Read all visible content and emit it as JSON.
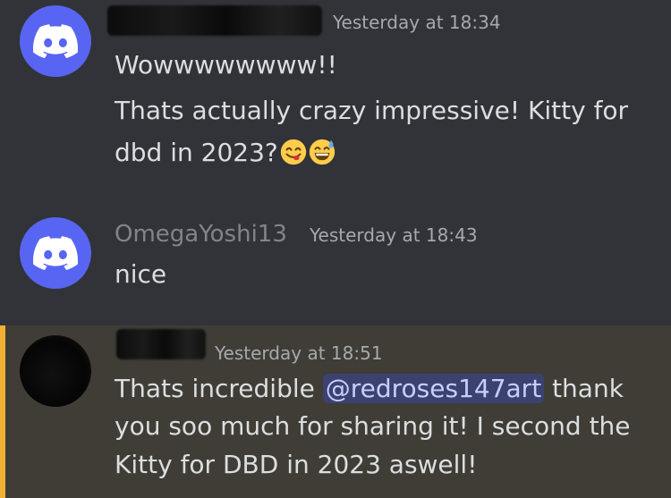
{
  "messages": [
    {
      "author_redacted": true,
      "timestamp": "Yesterday at 18:34",
      "lines": [
        "Wowwwwwwww!!",
        "Thats actually crazy impressive! Kitty for",
        "dbd in 2023?"
      ],
      "emojis": [
        "yum-face",
        "grinning-sweat-face"
      ]
    },
    {
      "author": "OmegaYoshi13",
      "timestamp": "Yesterday at 18:43",
      "lines": [
        "nice"
      ]
    },
    {
      "author_redacted": true,
      "timestamp": "Yesterday at 18:51",
      "text_before": "Thats incredible ",
      "mention": "@redroses147art",
      "text_after": " thank",
      "lines": [
        "you soo much for sharing it! I second the",
        "Kitty for DBD in 2023 aswell!"
      ],
      "highlighted": true
    }
  ],
  "colors": {
    "background": "#313338",
    "mention_highlight_bg": "#3f3d35",
    "mention_bar": "#f0b132",
    "discord_blurple": "#5865f2"
  }
}
